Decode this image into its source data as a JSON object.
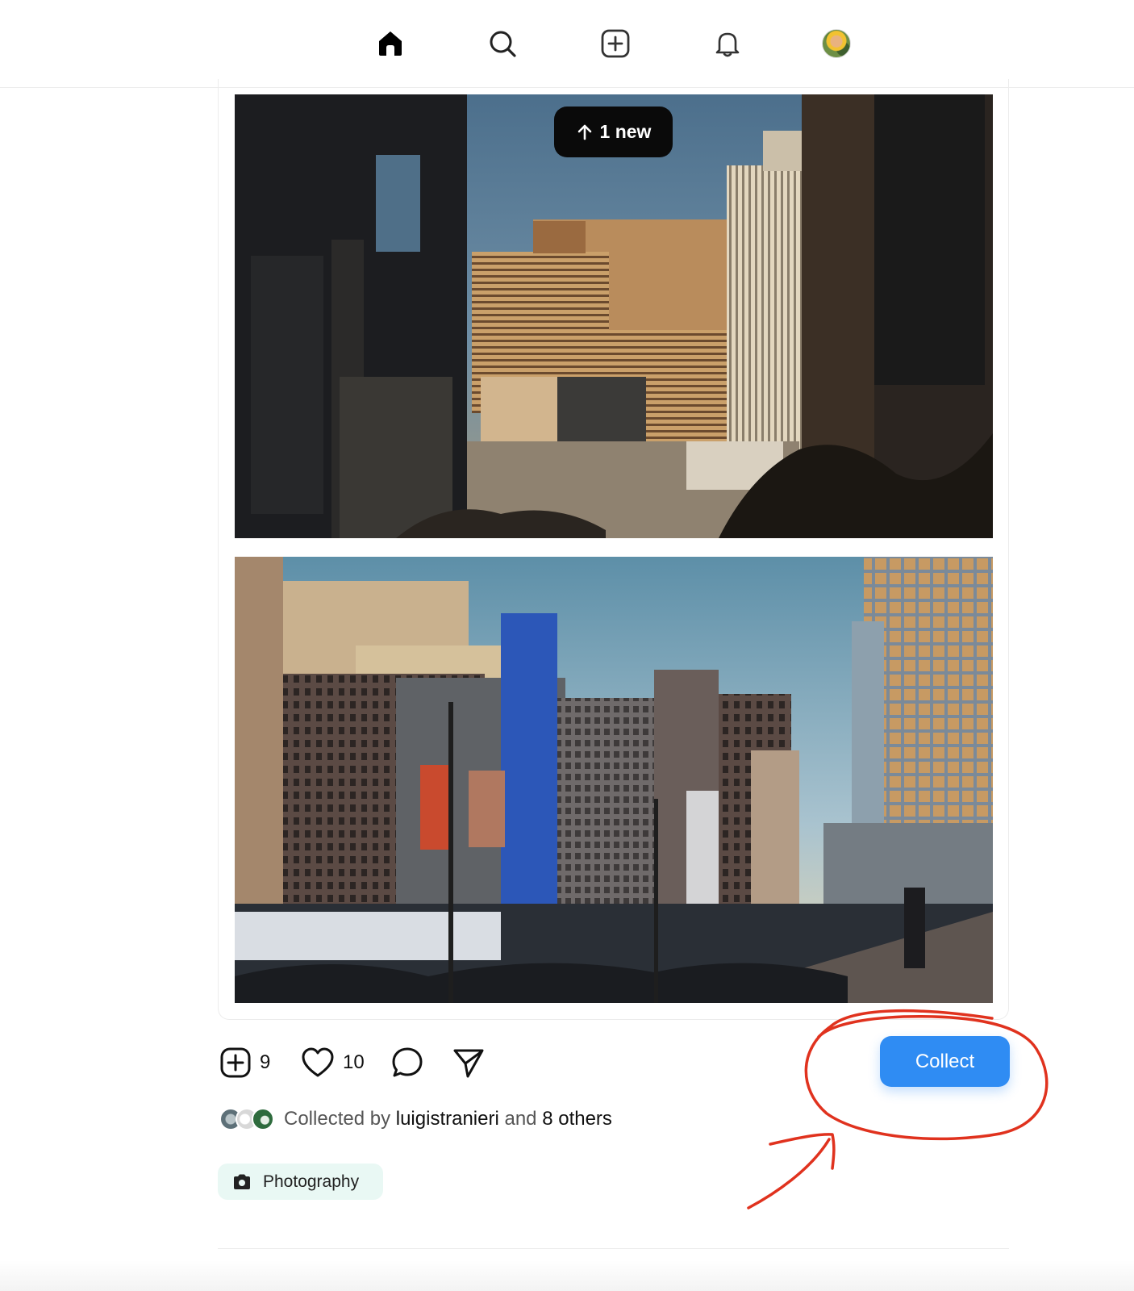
{
  "nav": {
    "items": [
      {
        "name": "home",
        "icon": "home-icon",
        "active": true
      },
      {
        "name": "search",
        "icon": "search-icon"
      },
      {
        "name": "create",
        "icon": "plus-square-icon"
      },
      {
        "name": "notifications",
        "icon": "bell-icon"
      },
      {
        "name": "profile",
        "icon": "avatar"
      }
    ]
  },
  "post": {
    "new_pill": {
      "icon": "arrow-up-icon",
      "label": "1 new"
    },
    "photos": [
      {
        "description_icon": "city-sunset-photo"
      },
      {
        "description_icon": "city-street-photo"
      }
    ],
    "actions": {
      "collects": {
        "icon": "plus-square-icon",
        "count": "9"
      },
      "likes": {
        "icon": "heart-icon",
        "count": "10"
      },
      "comments": {
        "icon": "comment-icon"
      },
      "share": {
        "icon": "send-icon"
      }
    },
    "collect_button": "Collect",
    "collected_by": {
      "prefix": "Collected by",
      "user": "luigistranieri",
      "and": "and",
      "others": "8 others"
    },
    "tag": {
      "icon": "camera-icon",
      "label": "Photography"
    }
  },
  "colors": {
    "accent": "#2f8cf3",
    "annotation": "#e0321e",
    "tag_bg": "#e9f8f4"
  }
}
